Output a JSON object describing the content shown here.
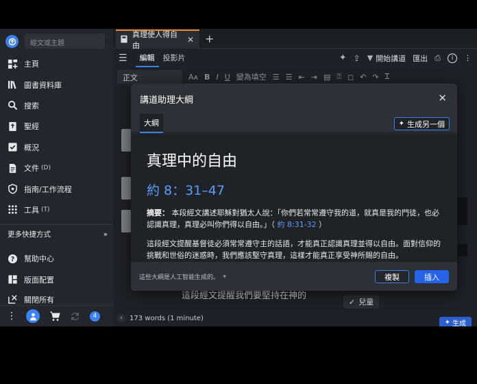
{
  "sidebar": {
    "search_placeholder": "經文或主題",
    "items": [
      {
        "label": "主頁",
        "shortcut": ""
      },
      {
        "label": "圖書資料庫",
        "shortcut": ""
      },
      {
        "label": "搜索",
        "shortcut": ""
      },
      {
        "label": "聖經",
        "shortcut": ""
      },
      {
        "label": "概況",
        "shortcut": ""
      },
      {
        "label": "文件",
        "shortcut": "(D)"
      },
      {
        "label": "指南/工作流程",
        "shortcut": ""
      },
      {
        "label": "工具",
        "shortcut": "(T)"
      }
    ],
    "more_shortcuts": "更多快捷方式",
    "secondary": [
      {
        "label": "幫助中心"
      },
      {
        "label": "版面配置"
      },
      {
        "label": "關閉所有"
      }
    ],
    "notification_count": "4"
  },
  "tab": {
    "title": "真理使人得自由"
  },
  "toolbar": {
    "edit_tab": "編輯",
    "slides_tab": "投影片",
    "start_preaching": "開始講道",
    "export": "匯出",
    "font": "正文",
    "fill_blank": "變為填空"
  },
  "document": {
    "visible_text": "這段經文提醒我們要堅持在神的",
    "chip_label": "兒童",
    "word_count": "173 words (1 minute)",
    "generate_label": "生成"
  },
  "modal": {
    "title": "講道助理大綱",
    "tab_outline": "大綱",
    "regenerate": "生成另一個",
    "outline_title": "真理中的自由",
    "reference": "約 8：31–47",
    "summary_label": "摘要：",
    "summary_text": "本段經文講述耶穌對猶太人說：「你們若常常遵守我的道，就真是我的門徒，也必認識真理，真理必叫你們得以自由。」（",
    "summary_link": "約 8:31-32",
    "summary_close": "）",
    "paragraph": "這段經文提醒基督徒必須常常遵守主的話語，才能真正認識真理並得以自由。面對信仰的挑戰和世俗的迷惑時，我們應該堅守真理，這樣才能真正享受神所賜的自由。",
    "ai_note": "這些大綱是人工智能生成的。",
    "copy_button": "複製",
    "insert_button": "插入"
  },
  "colors": {
    "accent": "#3f80e8",
    "tab_highlight": "#e8863a",
    "link": "#5b9df5"
  }
}
